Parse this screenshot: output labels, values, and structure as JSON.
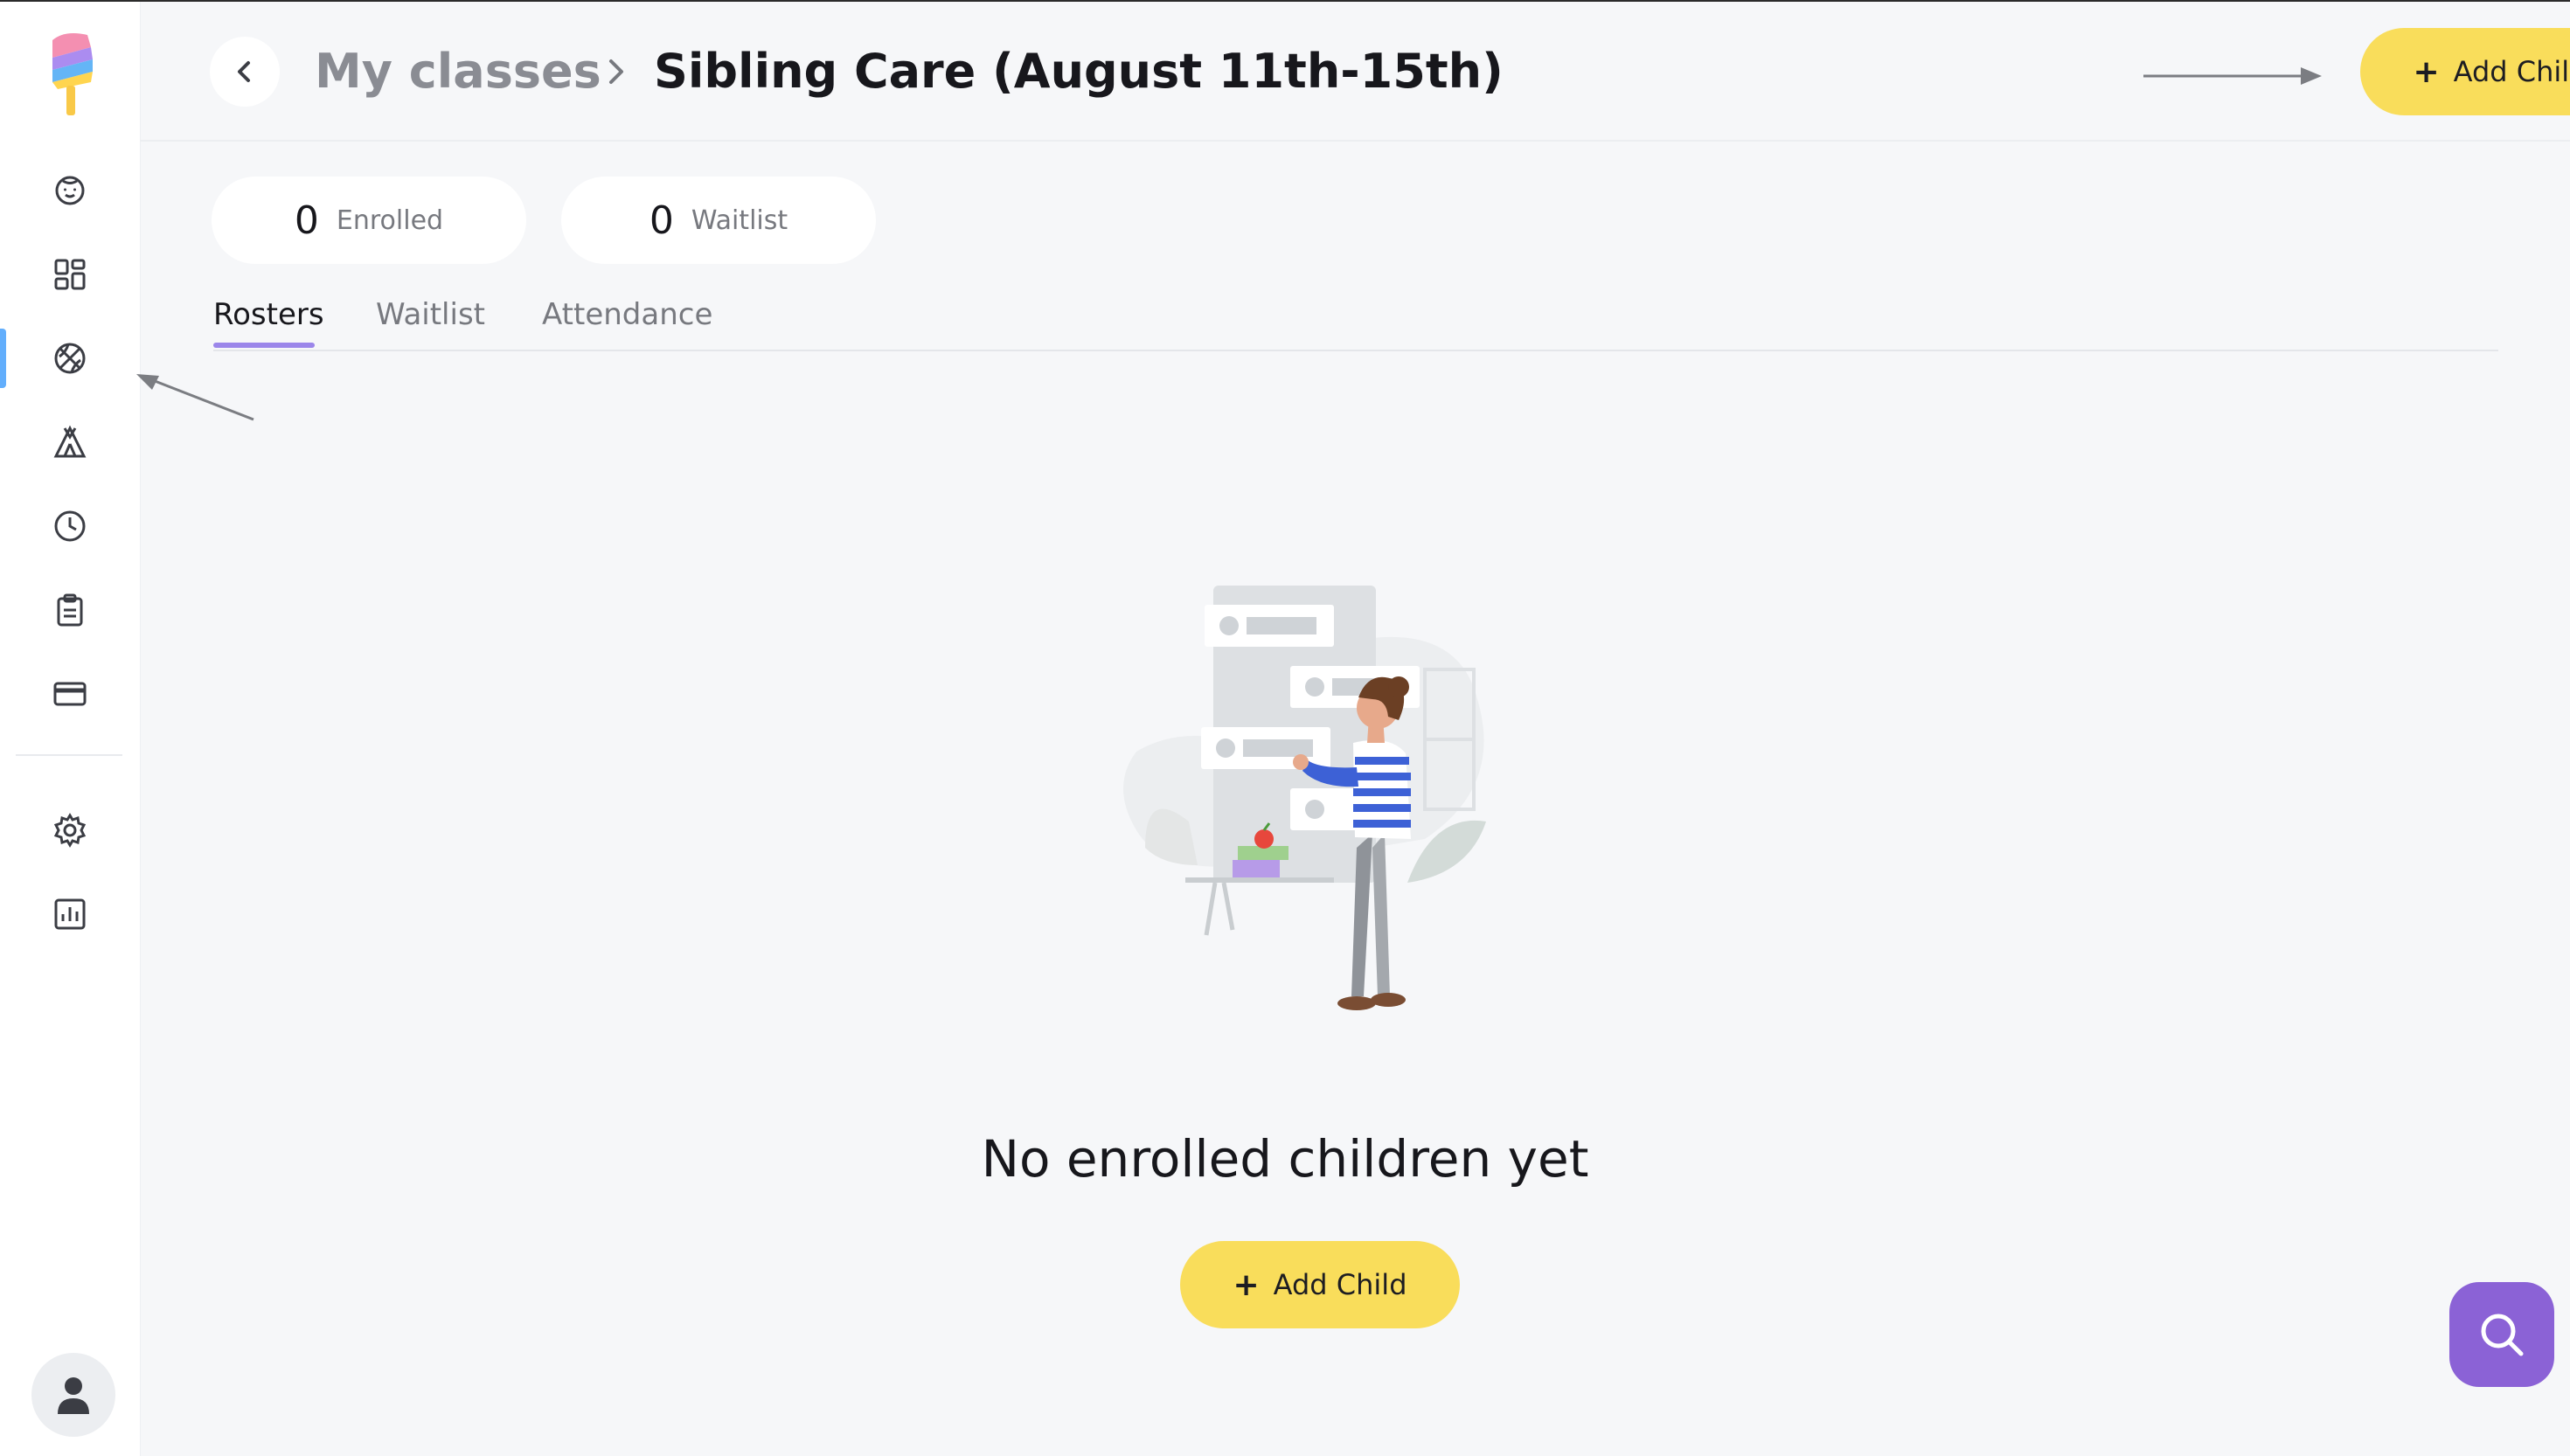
{
  "sidebar": {
    "items": [
      {
        "icon": "child-face-icon",
        "active": false
      },
      {
        "icon": "dashboard-icon",
        "active": false
      },
      {
        "icon": "basketball-icon",
        "active": true
      },
      {
        "icon": "camp-tent-icon",
        "active": false
      },
      {
        "icon": "clock-icon",
        "active": false
      },
      {
        "icon": "clipboard-icon",
        "active": false
      },
      {
        "icon": "credit-card-icon",
        "active": false
      },
      {
        "icon": "gear-icon",
        "active": false
      },
      {
        "icon": "reports-chart-icon",
        "active": false
      }
    ],
    "profile_icon": "user-avatar-icon"
  },
  "header": {
    "breadcrumb_parent": "My classes",
    "title": "Sibling Care (August 11th-15th)",
    "add_label": "Add Child"
  },
  "stats": {
    "enrolled": {
      "count": "0",
      "label": "Enrolled"
    },
    "waitlist": {
      "count": "0",
      "label": "Waitlist"
    }
  },
  "tabs": [
    {
      "label": "Rosters",
      "active": true
    },
    {
      "label": "Waitlist",
      "active": false
    },
    {
      "label": "Attendance",
      "active": false
    }
  ],
  "empty_state": {
    "message": "No enrolled children yet",
    "button_label": "Add Child"
  },
  "colors": {
    "accent_yellow": "#f9dd5b",
    "tab_underline": "#9b86ea",
    "active_nav": "#62aefc",
    "search_fab": "#8b62d6"
  }
}
